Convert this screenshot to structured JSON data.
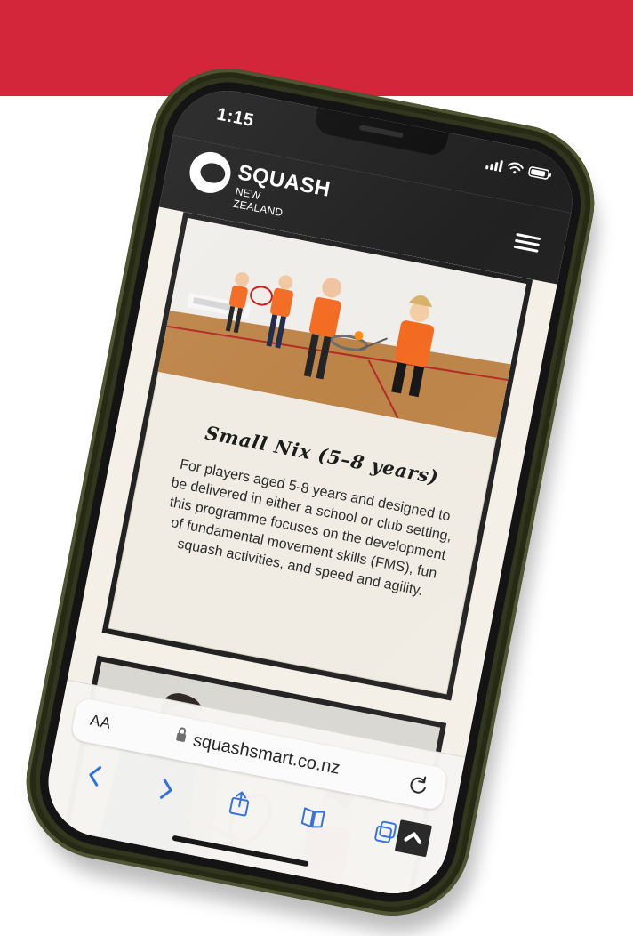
{
  "status": {
    "time": "1:15"
  },
  "brand": {
    "title": "SQUASH",
    "subtitle": "NEW ZEALAND"
  },
  "program": {
    "title": "Small Nix (5–8 years)",
    "description": "For players aged 5-8 years and designed to be delivered in either a school or club setting, this programme focuses on the development of fundamental movement skills (FMS), fun squash activities, and speed and agility."
  },
  "browser": {
    "reader_label": "AA",
    "domain": "squashsmart.co.nz"
  },
  "colors": {
    "accent_red": "#d3263b",
    "case_olive": "#33361f",
    "header_dark": "#212121",
    "screen_cream": "#f4f0e7"
  },
  "icons": {
    "menu": "hamburger-menu-icon",
    "reload": "reload-icon",
    "share": "share-icon",
    "bookmarks": "bookmarks-icon",
    "tabs": "tabs-icon",
    "back": "back-icon",
    "forward": "forward-icon",
    "scroll_top": "chevron-up-icon"
  }
}
